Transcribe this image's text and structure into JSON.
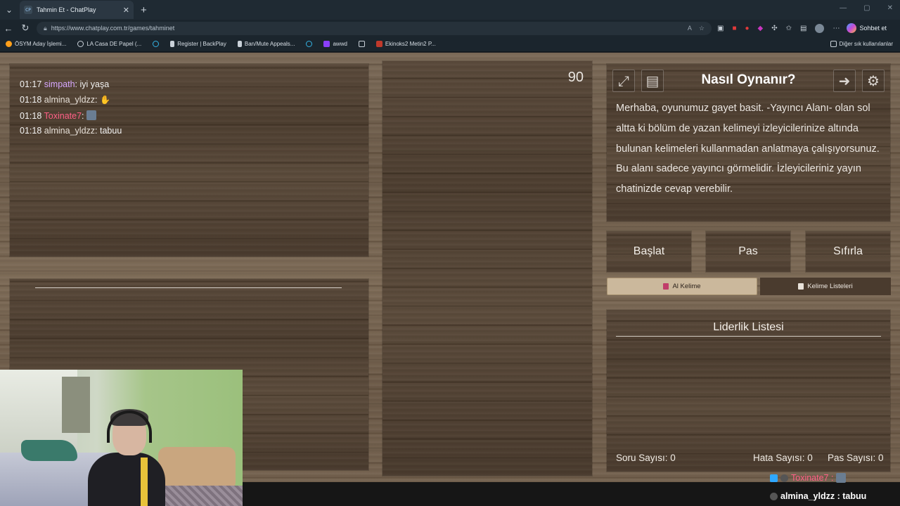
{
  "browser": {
    "tab_title": "Tahmin Et - ChatPlay",
    "tab_favicon": "CP",
    "url": "https://www.chatplay.com.tr/games/tahminet",
    "sohbet_label": "Sohbet et",
    "bookmarks": [
      {
        "label": "ÖSYM Aday İşlemi...",
        "color": "#ff9f1a"
      },
      {
        "label": "LA Casa DE Papel (...",
        "color": "#c9d1d9"
      },
      {
        "label": "",
        "color": "#34b3e4"
      },
      {
        "label": "Register | BackPlay",
        "color": "#c9d1d9"
      },
      {
        "label": "Ban/Mute Appeals...",
        "color": "#c9d1d9"
      },
      {
        "label": "",
        "color": "#34b3e4"
      },
      {
        "label": "awwd",
        "color": "#8a3ffc"
      },
      {
        "label": "",
        "color": "#c9d1d9"
      },
      {
        "label": "Ekinoks2 Metin2 P...",
        "color": "#c0392b"
      }
    ],
    "bookmarks_other": "Diğer sık kullanılanlar"
  },
  "chat": {
    "messages": [
      {
        "time": "01:17",
        "user": "simpath",
        "sep": ":",
        "text": "iyi yaşa",
        "user_color": "#d7a8ff"
      },
      {
        "time": "01:18",
        "user": "almina_yldzz",
        "sep": ":",
        "text": "✋",
        "user_color": "#e6dfd7"
      },
      {
        "time": "01:18",
        "user": "Toxinate7",
        "sep": ":",
        "text": "",
        "user_color": "#ff5f86"
      },
      {
        "time": "01:18",
        "user": "almina_yldzz",
        "sep": ":",
        "text": "tabuu",
        "user_color": "#e6dfd7"
      }
    ]
  },
  "game": {
    "timer": "90",
    "howto_title": "Nasıl Oynanır?",
    "howto_text": "Merhaba, oyunumuz gayet basit. -Yayıncı Alanı- olan sol altta ki bölüm de yazan kelimeyi izleyicilerinize altında bulunan kelimeleri kullanmadan anlatmaya çalışıyorsunuz. Bu alanı sadece yayıncı görmelidir. İzleyicileriniz yayın chatinizde cevap verebilir.",
    "buttons": {
      "start": "Başlat",
      "pass": "Pas",
      "reset": "Sıfırla"
    },
    "tabs": {
      "get_word": "Al Kelime",
      "word_lists": "Kelime Listeleri"
    },
    "leaderboard_title": "Liderlik Listesi",
    "stats": {
      "questions": "Soru Sayısı: 0",
      "errors": "Hata Sayısı: 0",
      "passes": "Pas Sayısı: 0"
    }
  },
  "overlay": {
    "line1_user": "Toxinate7 :",
    "line1_color": "#ff5f86",
    "line2": "almina_yldzz : tabuu"
  }
}
